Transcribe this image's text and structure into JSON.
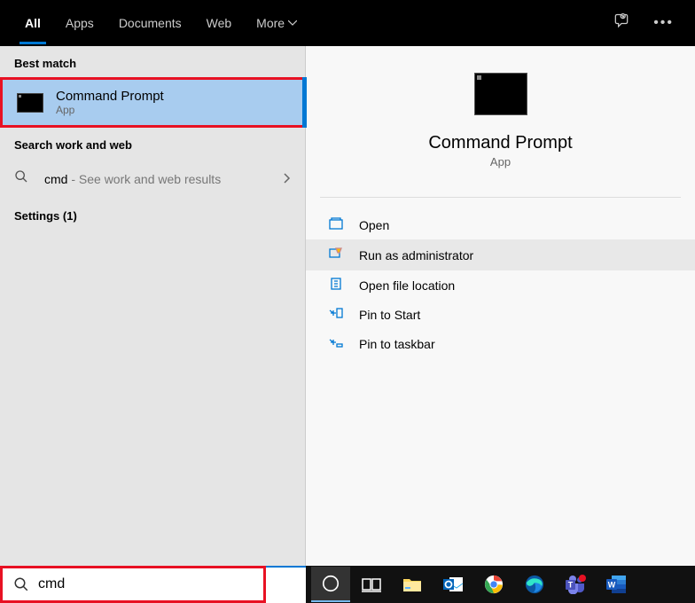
{
  "tabs": {
    "all": "All",
    "apps": "Apps",
    "documents": "Documents",
    "web": "Web",
    "more": "More"
  },
  "sections": {
    "best_match": "Best match",
    "search_work_web": "Search work and web",
    "settings": "Settings (1)"
  },
  "result": {
    "title": "Command Prompt",
    "subtitle": "App"
  },
  "web_result": {
    "query": "cmd",
    "hint": " - See work and web results"
  },
  "preview": {
    "title": "Command Prompt",
    "subtitle": "App"
  },
  "actions": {
    "open": "Open",
    "run_admin": "Run as administrator",
    "open_location": "Open file location",
    "pin_start": "Pin to Start",
    "pin_taskbar": "Pin to taskbar"
  },
  "search": {
    "value": "cmd"
  }
}
